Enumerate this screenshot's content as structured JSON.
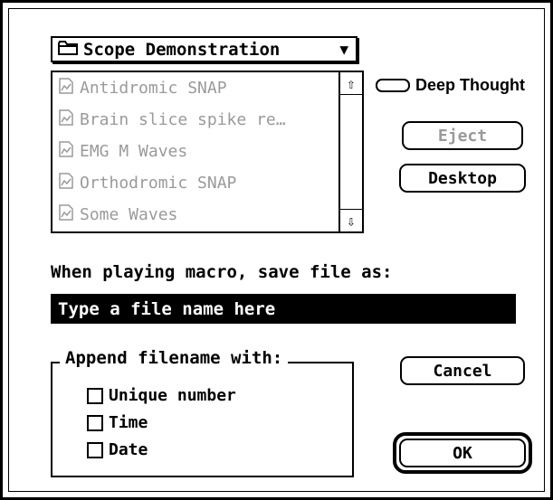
{
  "folder_popup": {
    "label": "Scope Demonstration",
    "icon": "folder-icon"
  },
  "file_list": {
    "items": [
      {
        "label": "Antidromic SNAP",
        "icon": "document-icon"
      },
      {
        "label": "Brain slice spike re…",
        "icon": "document-icon"
      },
      {
        "label": "EMG M Waves",
        "icon": "document-icon"
      },
      {
        "label": "Orthodromic SNAP",
        "icon": "document-icon"
      },
      {
        "label": "Some Waves",
        "icon": "document-icon"
      }
    ]
  },
  "drive": {
    "label": "Deep Thought",
    "icon": "drive-icon"
  },
  "buttons": {
    "eject": "Eject",
    "desktop": "Desktop",
    "cancel": "Cancel",
    "ok": "OK"
  },
  "save_prompt": "When playing macro, save file as:",
  "filename_field": {
    "value": "Type a file name here"
  },
  "append_group": {
    "legend": "Append filename with:",
    "options": [
      {
        "label": "Unique number",
        "checked": false
      },
      {
        "label": "Time",
        "checked": false
      },
      {
        "label": "Date",
        "checked": false
      }
    ]
  }
}
